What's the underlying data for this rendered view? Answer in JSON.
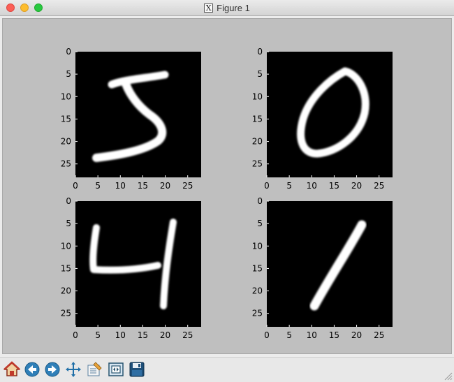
{
  "window": {
    "title": "Figure 1"
  },
  "figure": {
    "subplots": [
      {
        "digit": "5"
      },
      {
        "digit": "0"
      },
      {
        "digit": "4"
      },
      {
        "digit": "1"
      }
    ],
    "y_ticks": [
      "0",
      "5",
      "10",
      "15",
      "20",
      "25"
    ],
    "x_ticks": [
      "0",
      "5",
      "10",
      "15",
      "20",
      "25"
    ]
  },
  "toolbar": {
    "buttons": [
      {
        "name": "home-icon"
      },
      {
        "name": "back-icon"
      },
      {
        "name": "forward-icon"
      },
      {
        "name": "pan-icon"
      },
      {
        "name": "configure-subplots-icon"
      },
      {
        "name": "zoom-to-rect-icon"
      },
      {
        "name": "save-icon"
      }
    ]
  }
}
